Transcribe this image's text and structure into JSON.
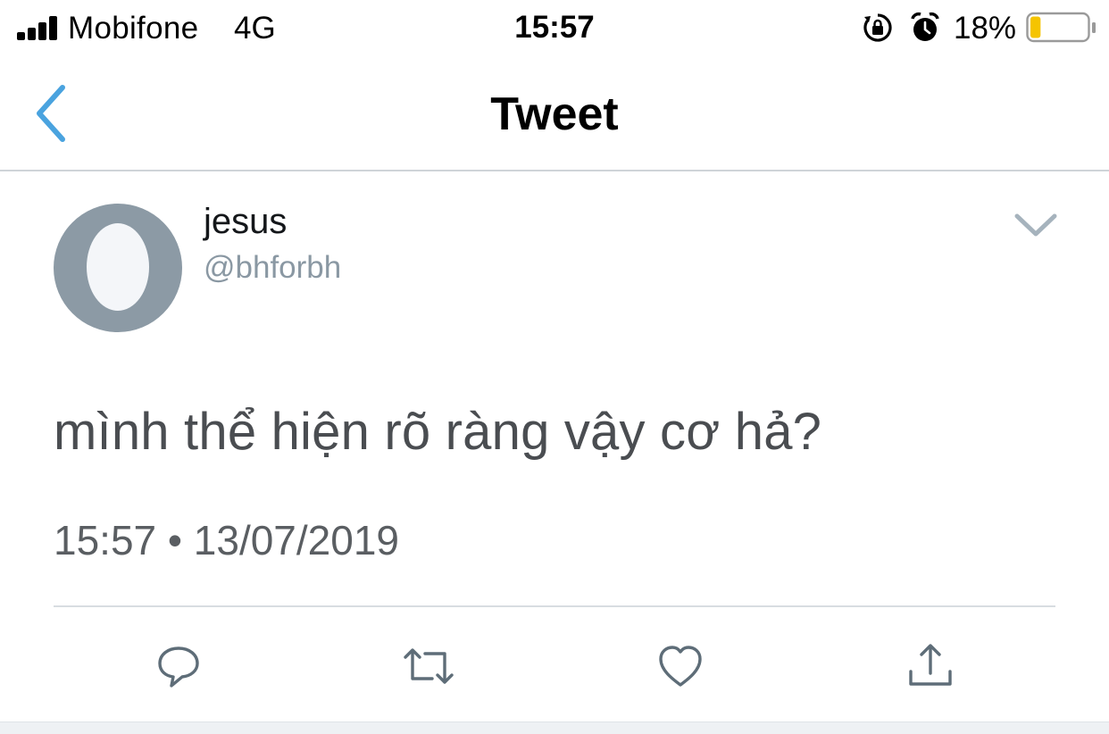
{
  "status_bar": {
    "carrier": "Mobifone",
    "network": "4G",
    "time": "15:57",
    "battery_percent": "18%",
    "battery_level": 0.18,
    "battery_color": "#f5c400",
    "icons": [
      "signal-icon",
      "orientation-lock-icon",
      "alarm-icon",
      "battery-icon"
    ]
  },
  "nav": {
    "title": "Tweet",
    "back_icon": "chevron-left-icon",
    "accent_color": "#4aa3df"
  },
  "tweet": {
    "display_name": "jesus",
    "handle": "@bhforbh",
    "text": "mình thể hiện rõ ràng vậy cơ hả?",
    "timestamp": "15:57 • 13/07/2019",
    "avatar": "default-egg-avatar",
    "menu_icon": "chevron-down-icon"
  },
  "actions": [
    {
      "name": "reply",
      "icon": "reply-icon"
    },
    {
      "name": "retweet",
      "icon": "retweet-icon"
    },
    {
      "name": "like",
      "icon": "heart-icon"
    },
    {
      "name": "share",
      "icon": "share-icon"
    }
  ]
}
